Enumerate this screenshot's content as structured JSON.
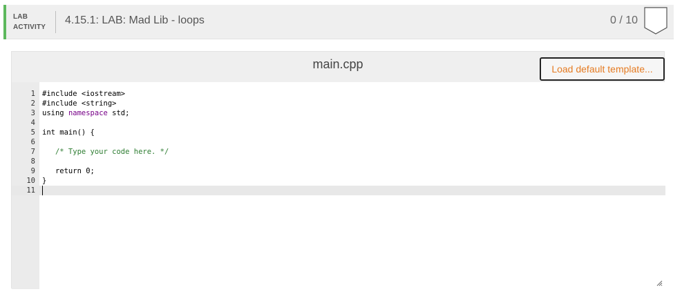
{
  "header": {
    "activity_label_line1": "LAB",
    "activity_label_line2": "ACTIVITY",
    "title": "4.15.1: LAB: Mad Lib - loops",
    "score": "0 / 10",
    "accent_color": "#5cb85c"
  },
  "editor": {
    "file_name": "main.cpp",
    "load_button_label": "Load default template...",
    "load_button_color": "#e57b22",
    "active_line": 11,
    "lines": [
      {
        "n": "1",
        "code": "#include <iostream>"
      },
      {
        "n": "2",
        "code": "#include <string>"
      },
      {
        "n": "3",
        "code": "using namespace std;"
      },
      {
        "n": "4",
        "code": ""
      },
      {
        "n": "5",
        "code": "int main() {"
      },
      {
        "n": "6",
        "code": ""
      },
      {
        "n": "7",
        "code": "   /* Type your code here. */"
      },
      {
        "n": "8",
        "code": ""
      },
      {
        "n": "9",
        "code": "   return 0;"
      },
      {
        "n": "10",
        "code": "}"
      },
      {
        "n": "11",
        "code": ""
      }
    ]
  }
}
